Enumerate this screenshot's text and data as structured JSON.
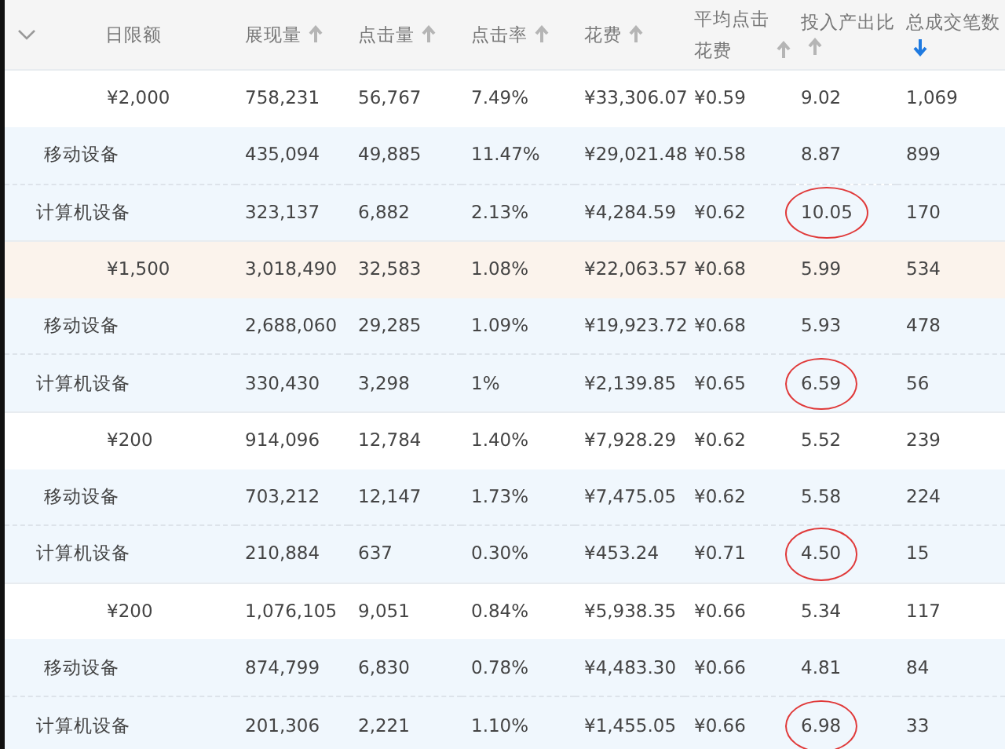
{
  "columns": [
    {
      "label": "日限额"
    },
    {
      "label": "展现量",
      "sorted": false
    },
    {
      "label": "点击量",
      "sorted": false
    },
    {
      "label": "点击率",
      "sorted": false
    },
    {
      "label": "花费",
      "sorted": false
    },
    {
      "label": "平均点击花费",
      "sorted": false
    },
    {
      "label": "投入产出比",
      "sorted": false
    },
    {
      "label": "总成交笔数",
      "sorted": true
    }
  ],
  "rows": [
    {
      "kind": "parent",
      "highlighted": false,
      "cells": [
        "¥2,000",
        "758,231",
        "56,767",
        "7.49%",
        "¥33,306.07",
        "¥0.59",
        "9.02",
        "1,069"
      ],
      "circled": false
    },
    {
      "kind": "child",
      "cells": [
        "移动设备",
        "435,094",
        "49,885",
        "11.47%",
        "¥29,021.48",
        "¥0.58",
        "8.87",
        "899"
      ],
      "circled": false
    },
    {
      "kind": "child",
      "cells": [
        "计算机设备",
        "323,137",
        "6,882",
        "2.13%",
        "¥4,284.59",
        "¥0.62",
        "10.05",
        "170"
      ],
      "circled": true
    },
    {
      "kind": "parent",
      "highlighted": true,
      "cells": [
        "¥1,500",
        "3,018,490",
        "32,583",
        "1.08%",
        "¥22,063.57",
        "¥0.68",
        "5.99",
        "534"
      ],
      "circled": false
    },
    {
      "kind": "child",
      "cells": [
        "移动设备",
        "2,688,060",
        "29,285",
        "1.09%",
        "¥19,923.72",
        "¥0.68",
        "5.93",
        "478"
      ],
      "circled": false
    },
    {
      "kind": "child",
      "cells": [
        "计算机设备",
        "330,430",
        "3,298",
        "1%",
        "¥2,139.85",
        "¥0.65",
        "6.59",
        "56"
      ],
      "circled": true
    },
    {
      "kind": "parent",
      "highlighted": false,
      "cells": [
        "¥200",
        "914,096",
        "12,784",
        "1.40%",
        "¥7,928.29",
        "¥0.62",
        "5.52",
        "239"
      ],
      "circled": false
    },
    {
      "kind": "child",
      "cells": [
        "移动设备",
        "703,212",
        "12,147",
        "1.73%",
        "¥7,475.05",
        "¥0.62",
        "5.58",
        "224"
      ],
      "circled": false
    },
    {
      "kind": "child",
      "cells": [
        "计算机设备",
        "210,884",
        "637",
        "0.30%",
        "¥453.24",
        "¥0.71",
        "4.50",
        "15"
      ],
      "circled": true
    },
    {
      "kind": "parent",
      "highlighted": false,
      "cells": [
        "¥200",
        "1,076,105",
        "9,051",
        "0.84%",
        "¥5,938.35",
        "¥0.66",
        "5.34",
        "117"
      ],
      "circled": false
    },
    {
      "kind": "child",
      "cells": [
        "移动设备",
        "874,799",
        "6,830",
        "0.78%",
        "¥4,483.30",
        "¥0.66",
        "4.81",
        "84"
      ],
      "circled": false
    },
    {
      "kind": "child",
      "cells": [
        "计算机设备",
        "201,306",
        "2,221",
        "1.10%",
        "¥1,455.05",
        "¥0.66",
        "6.98",
        "33"
      ],
      "circled": true
    }
  ]
}
